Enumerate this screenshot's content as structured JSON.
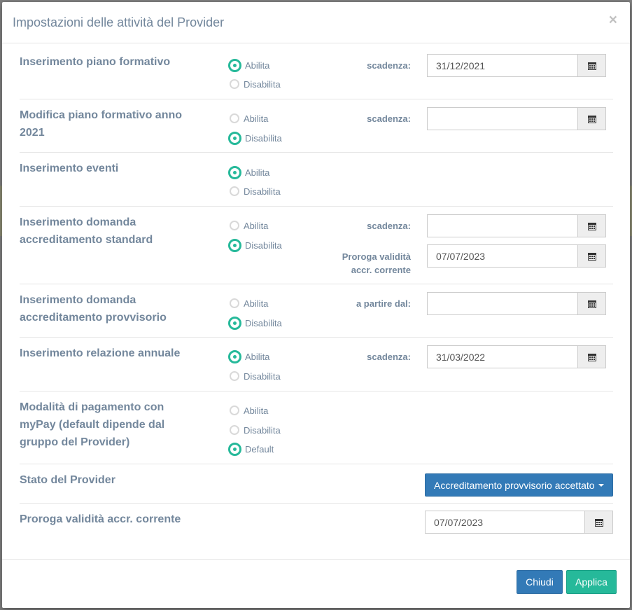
{
  "modal": {
    "title": "Impostazioni delle attività del Provider",
    "close_symbol": "×"
  },
  "options": {
    "enable": "Abilita",
    "disable": "Disabilita",
    "default": "Default"
  },
  "rows": [
    {
      "label": "Inserimento piano formativo",
      "selected": "Abilita",
      "field_label": "scadenza:",
      "field_value": "31/12/2021"
    },
    {
      "label_line1": "Modifica piano formativo anno",
      "label_line2": "2021",
      "selected": "Disabilita",
      "field_label": "scadenza:",
      "field_value": ""
    },
    {
      "label": "Inserimento eventi",
      "selected": "Abilita"
    },
    {
      "label_line1": "Inserimento domanda",
      "label_line2": "accreditamento standard",
      "selected": "Disabilita",
      "field_label": "scadenza:",
      "field_value": "",
      "field2_label_line1": "Proroga validità",
      "field2_label_line2": "accr. corrente",
      "field2_value": "07/07/2023"
    },
    {
      "label_line1": "Inserimento domanda",
      "label_line2": "accreditamento provvisorio",
      "selected": "Disabilita",
      "field_label": "a partire dal:",
      "field_value": ""
    },
    {
      "label": "Inserimento relazione annuale",
      "selected": "Abilita",
      "field_label": "scadenza:",
      "field_value": "31/03/2022"
    },
    {
      "label_line1": "Modalità di pagamento con",
      "label_line2": "myPay (default dipende dal",
      "label_line3": "gruppo del Provider)",
      "selected": "Default"
    }
  ],
  "provider_state": {
    "label": "Stato del Provider",
    "value": "Accreditamento provvisorio accettato"
  },
  "proroga": {
    "label": "Proroga validità accr. corrente",
    "value": "07/07/2023"
  },
  "footer": {
    "close_label": "Chiudi",
    "apply_label": "Applica"
  },
  "colors": {
    "accent_green": "#26b99a",
    "primary_blue": "#337ab7",
    "text": "#73879c"
  }
}
